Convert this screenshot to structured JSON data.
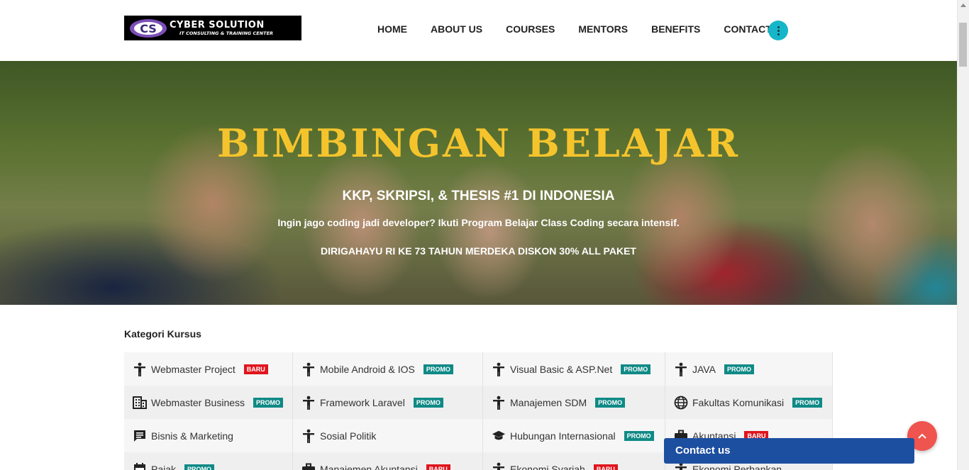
{
  "header": {
    "logo": {
      "name": "CYBER SOLUTION",
      "tagline": "IT CONSULTING & TRAINING CENTER",
      "mark": "CS"
    },
    "nav": [
      "HOME",
      "ABOUT US",
      "COURSES",
      "MENTORS",
      "BENEFITS",
      "CONTACTS"
    ],
    "menu_icon": "more-vertical-icon",
    "accent_color": "#16b6c8"
  },
  "hero": {
    "title": "BIMBINGAN BELAJAR",
    "subtitle": "KKP, SKRIPSI, & THESIS #1 DI INDONESIA",
    "line": "Ingin jago coding jadi developer? Ikuti Program Belajar Class Coding secara intensif.",
    "promo": "DIRIGAHAYU RI KE 73 TAHUN MERDEKA DISKON 30% ALL PAKET",
    "title_color": "#f5c42c"
  },
  "categories": {
    "title": "Kategori Kursus",
    "badge_colors": {
      "PROMO": "#0f8a86",
      "BARU": "#e0151d"
    },
    "rows": [
      [
        {
          "label": "Webmaster Project",
          "badge": "BARU",
          "icon": "person-icon"
        },
        {
          "label": "Mobile Android & IOS",
          "badge": "PROMO",
          "icon": "person-icon"
        },
        {
          "label": "Visual Basic & ASP.Net",
          "badge": "PROMO",
          "icon": "person-icon"
        },
        {
          "label": "JAVA",
          "badge": "PROMO",
          "icon": "person-icon"
        }
      ],
      [
        {
          "label": "Webmaster Business",
          "badge": "PROMO",
          "icon": "building-icon"
        },
        {
          "label": "Framework Laravel",
          "badge": "PROMO",
          "icon": "person-icon"
        },
        {
          "label": "Manajemen SDM",
          "badge": "PROMO",
          "icon": "person-icon"
        },
        {
          "label": "Fakultas Komunikasi",
          "badge": "PROMO",
          "icon": "globe-icon"
        }
      ],
      [
        {
          "label": "Bisnis & Marketing",
          "badge": "",
          "icon": "chat-icon"
        },
        {
          "label": "Sosial Politik",
          "badge": "",
          "icon": "person-icon"
        },
        {
          "label": "Hubungan Internasional",
          "badge": "PROMO",
          "icon": "graduation-cap-icon"
        },
        {
          "label": "Akuntansi",
          "badge": "BARU",
          "icon": "briefcase-icon"
        }
      ],
      [
        {
          "label": "Pajak",
          "badge": "PROMO",
          "icon": "calendar-icon"
        },
        {
          "label": "Manajemen Akuntansi",
          "badge": "BARU",
          "icon": "briefcase-icon"
        },
        {
          "label": "Ekonomi Syariah",
          "badge": "BARU",
          "icon": "person-icon"
        },
        {
          "label": "Ekonomi Perbankan",
          "badge": "",
          "icon": "person-icon"
        }
      ]
    ]
  },
  "floating": {
    "contact_label": "Contact us",
    "scroll_top_icon": "chevron-up-icon",
    "contact_color": "#1d4fa0",
    "scroll_top_color": "#f0544e"
  }
}
